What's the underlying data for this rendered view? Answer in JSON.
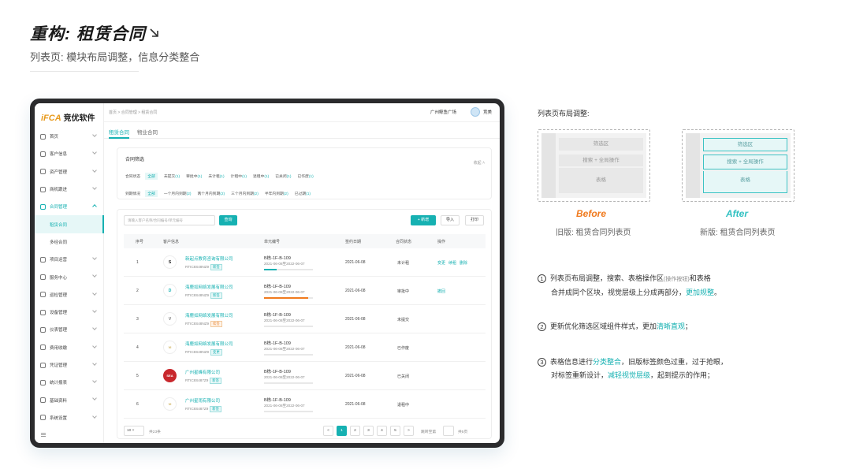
{
  "header": {
    "title": "重构: 租赁合同",
    "subtitle": "列表页: 模块布局调整，信息分类整合"
  },
  "colors": {
    "accent": "#16b1b2",
    "before": "#f07a1e",
    "after": "#2fc0c1"
  },
  "app": {
    "logo_mark": "iFCA",
    "logo_name": "竞优软件",
    "sidebar": [
      {
        "label": "首页",
        "icon": "home-icon"
      },
      {
        "label": "客户信息",
        "icon": "customer-icon"
      },
      {
        "label": "资产管理",
        "icon": "asset-icon"
      },
      {
        "label": "商机跟进",
        "icon": "opportunity-icon"
      },
      {
        "label": "合同管理",
        "icon": "contract-icon"
      },
      {
        "label": "租赁合同",
        "icon": ""
      },
      {
        "label": "多经合同",
        "icon": ""
      },
      {
        "label": "项目运营",
        "icon": "project-icon"
      },
      {
        "label": "服务中心",
        "icon": "service-icon"
      },
      {
        "label": "巡检管理",
        "icon": "inspection-icon"
      },
      {
        "label": "设备管理",
        "icon": "device-icon"
      },
      {
        "label": "仪表管理",
        "icon": "meter-icon"
      },
      {
        "label": "费用收缴",
        "icon": "fee-icon"
      },
      {
        "label": "凭证管理",
        "icon": "voucher-icon"
      },
      {
        "label": "统计报表",
        "icon": "report-icon"
      },
      {
        "label": "基础资料",
        "icon": "basic-data-icon"
      },
      {
        "label": "系统设置",
        "icon": "settings-icon"
      }
    ],
    "breadcrumb": "首页  >  合同管理  >  租赁合同",
    "location": "广州鲸鱼广场",
    "user": "竞美",
    "tabs": [
      "租赁合同",
      "物业合同"
    ],
    "filter": {
      "title": "合同筛选",
      "collapse": "收起",
      "row1_label": "合同状态",
      "row1": [
        {
          "label": "全部",
          "count": ""
        },
        {
          "label": "未提交",
          "count": "(1)"
        },
        {
          "label": "审批中",
          "count": "(1)"
        },
        {
          "label": "未计租",
          "count": "(1)"
        },
        {
          "label": "计租中",
          "count": "(1)"
        },
        {
          "label": "退租中",
          "count": "(1)"
        },
        {
          "label": "已关闭",
          "count": "(1)"
        },
        {
          "label": "已作废",
          "count": "(1)"
        }
      ],
      "row2_label": "到期情况",
      "row2": [
        {
          "label": "全部",
          "count": ""
        },
        {
          "label": "一个月内到期",
          "count": "(2)"
        },
        {
          "label": "两个月内到期",
          "count": "(2)"
        },
        {
          "label": "三个月内到期",
          "count": "(2)"
        },
        {
          "label": "半年内到期",
          "count": "(2)"
        },
        {
          "label": "已过期",
          "count": "(1)"
        }
      ]
    },
    "search_placeholder": "请输入客户名称/合同编号/单元编号",
    "btn_query": "查询",
    "btn_add": "+ 新增",
    "btn_import": "导入",
    "btn_print": "打印",
    "columns": [
      "序号",
      "客户信息",
      "单元编号",
      "签约日期",
      "合同状态",
      "操作"
    ],
    "rows": [
      {
        "no": "1",
        "logo": "S",
        "company": "新起点教育咨询有限公司",
        "code": "RTIC8S48NZ9",
        "tag": "新签",
        "tag_type": "normal",
        "unit": "B栋-1F-B-109",
        "range": "2021-06-08至2022-06-07",
        "progress": 0.25,
        "bar": "#16b1b2",
        "date": "2021-06-08",
        "status": "未计租",
        "ops": [
          "变更",
          "续租",
          "删除"
        ]
      },
      {
        "no": "2",
        "logo": "D",
        "company": "海鹿如网络发展有限公司",
        "code": "RTIC8S48NZ9",
        "tag": "新签",
        "tag_type": "normal",
        "unit": "B栋-1F-B-109",
        "range": "2021-06-08至2022-06-07",
        "progress": 0.9,
        "bar": "#f07a1e",
        "date": "2021-06-08",
        "status": "审批中",
        "ops": [
          "撤回"
        ]
      },
      {
        "no": "3",
        "logo": "V",
        "company": "海鹿如网络发展有限公司",
        "code": "RTIC8S48NZ9",
        "tag": "续签",
        "tag_type": "warn",
        "unit": "B栋-1F-B-109",
        "range": "2021-06-08至2022-06-07",
        "progress": 0,
        "bar": "#16b1b2",
        "date": "2021-06-08",
        "status": "未提交",
        "ops": []
      },
      {
        "no": "4",
        "logo": "VI",
        "company": "海鹿如网络发展有限公司",
        "code": "RTIC8S48NZ9",
        "tag": "变更",
        "tag_type": "normal",
        "unit": "B栋-1F-B-109",
        "range": "2021-06-08至2022-06-07",
        "progress": 0,
        "bar": "#16b1b2",
        "date": "2021-06-08",
        "status": "已作废",
        "ops": []
      },
      {
        "no": "5",
        "logo": "SEA",
        "company": "广州星峰有限公司",
        "code": "RTIC8S487Z9",
        "tag": "新签",
        "tag_type": "normal",
        "unit": "B栋-1F-B-109",
        "range": "2021-06-08至2022-06-07",
        "progress": 0,
        "bar": "#16b1b2",
        "date": "2021-06-08",
        "status": "已关闭",
        "ops": []
      },
      {
        "no": "6",
        "logo": "VI",
        "company": "广州星雨有限公司",
        "code": "RTIC8S487Z9",
        "tag": "新签",
        "tag_type": "normal",
        "unit": "B栋-1F-B-109",
        "range": "2021-06-08至2022-06-07",
        "progress": 0,
        "bar": "#16b1b2",
        "date": "2021-06-08",
        "status": "退租中",
        "ops": []
      }
    ],
    "pager": {
      "size": "10",
      "total": "共23条",
      "pages": [
        "<",
        "1",
        "2",
        "3",
        "4",
        "5",
        ">"
      ],
      "current": "1",
      "jump": "跳转至第",
      "unit": "共5页"
    }
  },
  "panel": {
    "title": "列表页布局调整:",
    "before": {
      "tag": "Before",
      "caption": "旧版: 租赁合同列表页",
      "blocks": [
        "筛选区",
        "搜索 + 全局操作",
        "表格"
      ]
    },
    "after": {
      "tag": "After",
      "caption": "新版: 租赁合同列表页",
      "blocks": [
        "筛选区",
        "搜索 + 全局操作",
        "表格"
      ]
    },
    "notes": [
      {
        "num": "1",
        "l1a": "列表页布局调整，搜索、表格操作区",
        "l1b": "(操作按钮)",
        "l1c": "和表格",
        "l2a": "合并成同个区块，视觉层级上分成两部分，",
        "l2b": "更加规整",
        "l2c": "。"
      },
      {
        "num": "2",
        "l1a": "更新优化筛选区域组件样式，更加",
        "l1b": "清晰直观",
        "l1c": "；"
      },
      {
        "num": "3",
        "l1a": "表格信息进行",
        "l1b": "分类整合",
        "l1c": "，旧版标签颜色过重，过于抢眼，",
        "l2a": "对标签重新设计，",
        "l2b": "减轻视觉层级",
        "l2c": "，起到提示的作用；"
      }
    ]
  }
}
